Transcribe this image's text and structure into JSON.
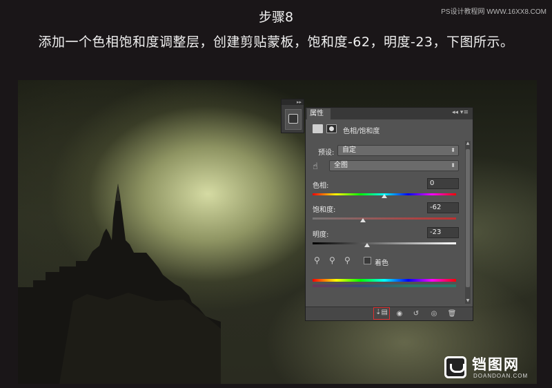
{
  "header": {
    "step_title": "步骤8",
    "description": "添加一个色相饱和度调整层，创建剪贴蒙板，饱和度-62，明度-23，下图所示。",
    "site_mark": "PS设计教程网 WWW.16XX8.COM"
  },
  "panel": {
    "tab_label": "属性",
    "menu_icon": "panel-menu-icon",
    "adjustment_title": "色相/饱和度",
    "preset_label": "预设:",
    "preset_value": "自定",
    "channel_value": "全图",
    "hue_label": "色相:",
    "hue_value": "0",
    "hue_level": 0.5,
    "saturation_label": "饱和度:",
    "saturation_value": "-62",
    "saturation_level": 0.35,
    "lightness_label": "明度:",
    "lightness_value": "-23",
    "lightness_level": 0.38,
    "colorize_label": "着色",
    "colorize_checked": false,
    "footer_buttons": [
      "clip-to-layer-icon",
      "view-previous-icon",
      "reset-icon",
      "visibility-icon",
      "delete-icon"
    ]
  },
  "watermark": {
    "name": "铛图网",
    "url": "DOANDOAN.COM"
  },
  "colors": {
    "page_bg": "#1a1618",
    "panel_bg": "#535353",
    "clip_highlight": "#e03030"
  }
}
